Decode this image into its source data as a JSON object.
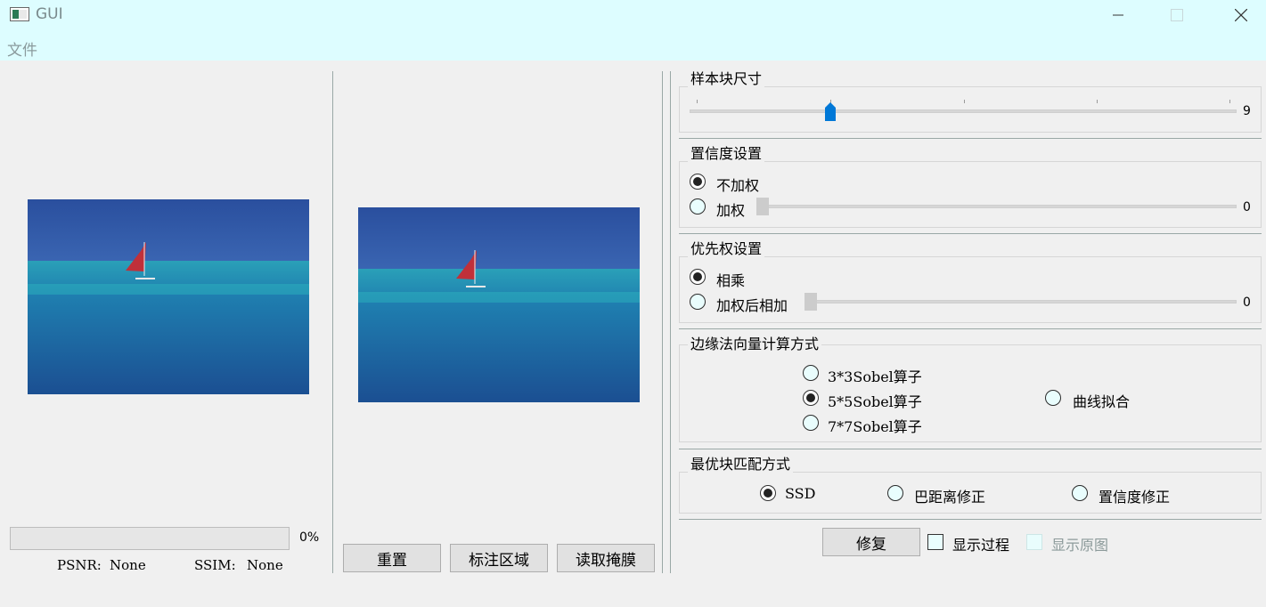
{
  "window": {
    "title": "GUI"
  },
  "menu": {
    "file": "文件"
  },
  "left_panel": {
    "progress_percent": 0,
    "progress_text": "0%",
    "psnr_label": "PSNR:",
    "psnr_value": "None",
    "ssim_label": "SSIM:",
    "ssim_value": "None"
  },
  "middle_panel": {
    "buttons": [
      "重置",
      "标注区域",
      "读取掩膜"
    ]
  },
  "patch_size": {
    "title": "样本块尺寸",
    "value": "9",
    "slider_fraction": 0.26
  },
  "confidence": {
    "title": "置信度设置",
    "options": [
      "不加权",
      "加权"
    ],
    "selected": "不加权",
    "slider_value": "0"
  },
  "priority": {
    "title": "优先权设置",
    "options": [
      "相乘",
      "加权后相加"
    ],
    "selected": "相乘",
    "slider_value": "0"
  },
  "edge_normal": {
    "title": "边缘法向量计算方式",
    "options": [
      "3*3Sobel算子",
      "5*5Sobel算子",
      "7*7Sobel算子",
      "曲线拟合"
    ],
    "selected": "5*5Sobel算子"
  },
  "matching": {
    "title": "最优块匹配方式",
    "options": [
      "SSD",
      "巴距离修正",
      "置信度修正"
    ],
    "selected": "SSD"
  },
  "bottom": {
    "repair_button": "修复",
    "show_process": "显示过程",
    "show_original": "显示原图"
  },
  "colors": {
    "titlebar": "#ddfdff",
    "slider_handle": "#0078d7",
    "sky": "#2e54a3",
    "sea": "#1b6fa8"
  }
}
